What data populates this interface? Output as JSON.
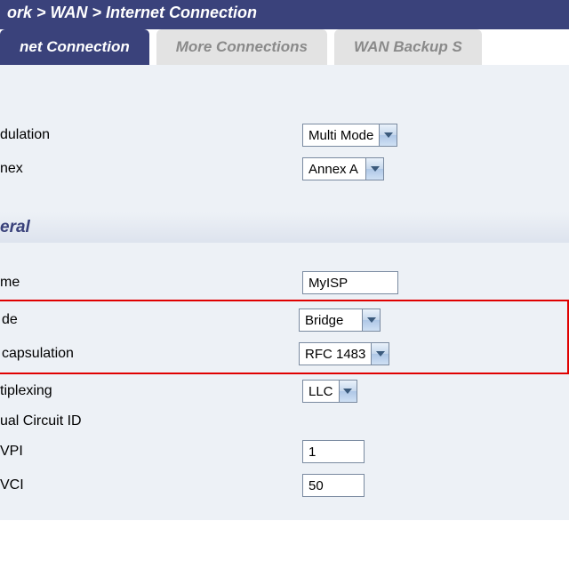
{
  "breadcrumb": "ork  >  WAN  >  Internet Connection",
  "tabs": {
    "t0": "net Connection",
    "t1": "More Connections",
    "t2": "WAN Backup S"
  },
  "section1_heading": "",
  "section2_heading": "eral",
  "labels": {
    "modulation": "dulation",
    "annex": "nex",
    "name": "me",
    "mode": "de",
    "encap": "capsulation",
    "mux": "tiplexing",
    "vcid": "ual Circuit ID",
    "vpi": "VPI",
    "vci": "VCI"
  },
  "values": {
    "modulation": "Multi Mode",
    "annex": "Annex A",
    "name": "MyISP",
    "mode": "Bridge",
    "encap": "RFC 1483",
    "mux": "LLC",
    "vpi": "1",
    "vci": "50"
  }
}
